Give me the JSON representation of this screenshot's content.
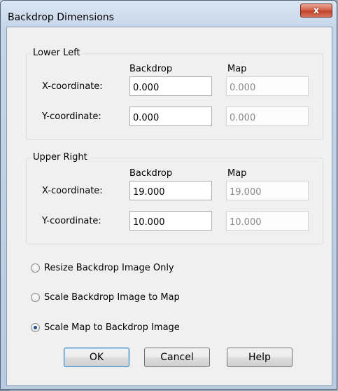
{
  "window": {
    "title": "Backdrop Dimensions",
    "close_label": "x"
  },
  "lower_left": {
    "group_label": "Lower Left",
    "col_backdrop": "Backdrop",
    "col_map": "Map",
    "x_label": "X-coordinate:",
    "y_label": "Y-coordinate:",
    "x_backdrop": "0.000",
    "x_map": "0.000",
    "y_backdrop": "0.000",
    "y_map": "0.000"
  },
  "upper_right": {
    "group_label": "Upper Right",
    "col_backdrop": "Backdrop",
    "col_map": "Map",
    "x_label": "X-coordinate:",
    "y_label": "Y-coordinate:",
    "x_backdrop": "19.000",
    "x_map": "19.000",
    "y_backdrop": "10.000",
    "y_map": "10.000"
  },
  "options": [
    {
      "label": "Resize Backdrop Image Only",
      "selected": false
    },
    {
      "label": "Scale Backdrop Image to Map",
      "selected": false
    },
    {
      "label": "Scale Map to Backdrop Image",
      "selected": true
    }
  ],
  "buttons": {
    "ok": "OK",
    "cancel": "Cancel",
    "help": "Help"
  }
}
